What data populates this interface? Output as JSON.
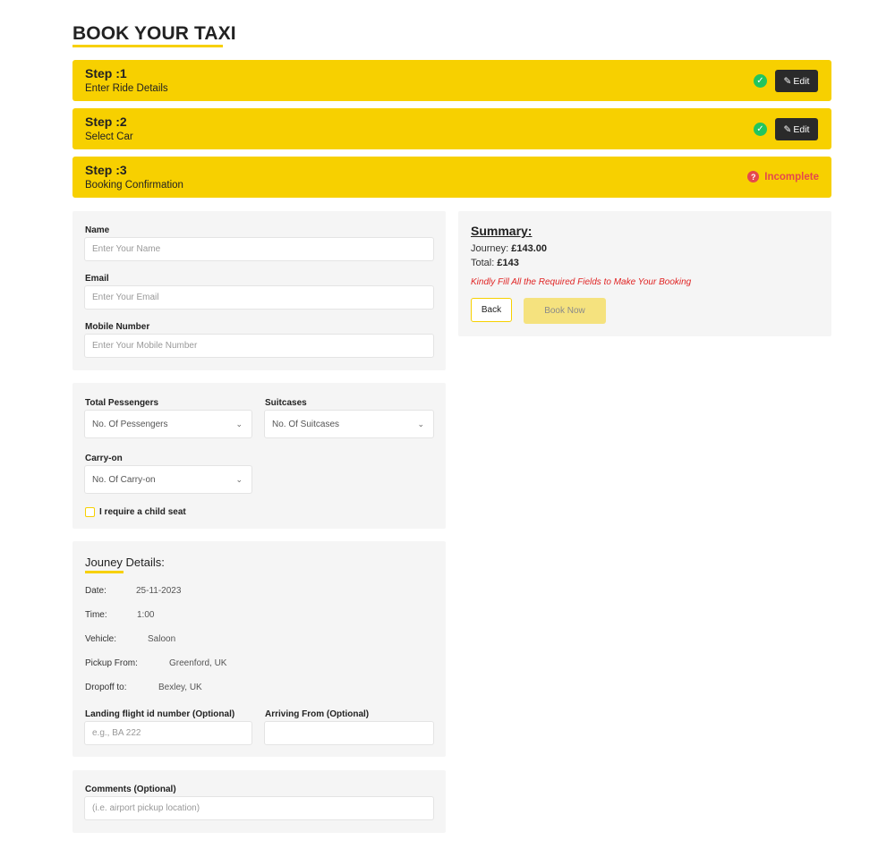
{
  "page": {
    "title": "BOOK YOUR TAXI"
  },
  "steps": [
    {
      "number": "Step :1",
      "subtitle": "Enter Ride Details",
      "status": "complete",
      "edit_label": "Edit"
    },
    {
      "number": "Step :2",
      "subtitle": "Select Car",
      "status": "complete",
      "edit_label": "Edit"
    },
    {
      "number": "Step :3",
      "subtitle": "Booking Confirmation",
      "status": "incomplete",
      "status_label": "Incomplete"
    }
  ],
  "contact": {
    "name_label": "Name",
    "name_placeholder": "Enter Your Name",
    "email_label": "Email",
    "email_placeholder": "Enter Your Email",
    "mobile_label": "Mobile Number",
    "mobile_placeholder": "Enter Your Mobile Number"
  },
  "luggage": {
    "passengers_label": "Total Pessengers",
    "passengers_value": "No. Of Pessengers",
    "suitcases_label": "Suitcases",
    "suitcases_value": "No. Of Suitcases",
    "carryon_label": "Carry-on",
    "carryon_value": "No. Of Carry-on",
    "child_seat_label": "I require a child seat"
  },
  "journey": {
    "heading": "Jouney Details:",
    "date_label": "Date:",
    "date_value": "25-11-2023",
    "time_label": "Time:",
    "time_value": "1:00",
    "vehicle_label": "Vehicle:",
    "vehicle_value": "Saloon",
    "pickup_label": "Pickup From:",
    "pickup_value": "Greenford, UK",
    "dropoff_label": "Dropoff to:",
    "dropoff_value": "Bexley, UK",
    "flight_label": "Landing flight id number (Optional)",
    "flight_placeholder": "e.g., BA 222",
    "arriving_label": "Arriving From (Optional)",
    "arriving_placeholder": ""
  },
  "comments": {
    "label": "Comments (Optional)",
    "placeholder": "(i.e. airport pickup location)"
  },
  "summary": {
    "title": "Summary:",
    "journey_label": "Journey:",
    "journey_value": "£143.00",
    "total_label": "Total:",
    "total_value": "£143",
    "warning": "Kindly Fill All the Required Fields to Make Your Booking",
    "back_label": "Back",
    "book_label": "Book Now"
  },
  "colors": {
    "accent": "#f7d000",
    "success": "#22c55e",
    "danger": "#e5484d",
    "panel": "#f5f5f5",
    "dark_button": "#2a2a2a"
  }
}
